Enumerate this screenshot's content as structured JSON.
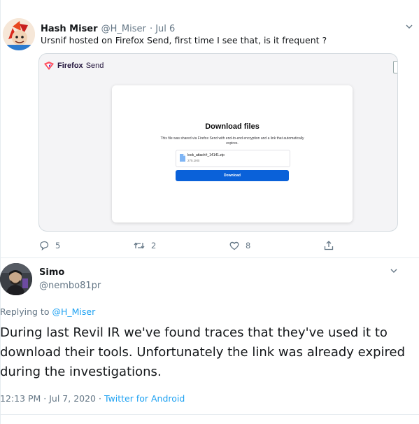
{
  "quoted_tweet": {
    "author_name": "Hash Miser",
    "author_handle": "@H_Miser",
    "date": "· Jul 6",
    "text": "Ursnif hosted on Firefox Send, first time I see that, is it frequent ?",
    "card": {
      "brand_name": "Firefox",
      "brand_suffix": "Send",
      "modal_title": "Download files",
      "modal_description": "This file was shared via Firefox Send with end-to-end encryption and a link that automatically expires.",
      "file_name": "look_attach#_14141.zip",
      "file_size": "275.1KB",
      "download_label": "Download"
    },
    "actions": {
      "reply_count": "5",
      "retweet_count": "2",
      "like_count": "8"
    }
  },
  "main_tweet": {
    "author_name": "Simo",
    "author_handle": "@nembo81pr",
    "replying_prefix": "Replying to",
    "replying_handle": "@H_Miser",
    "text": "During last Revil IR we've found traces that they've used it to download their tools. Unfortunately the link was already expired during the investigations.",
    "timestamp": "12:13 PM · Jul 7, 2020 ·",
    "source": "Twitter for Android"
  },
  "colors": {
    "accent": "#1da1f2",
    "muted": "#657786",
    "firefox_button": "#0a61d9"
  }
}
